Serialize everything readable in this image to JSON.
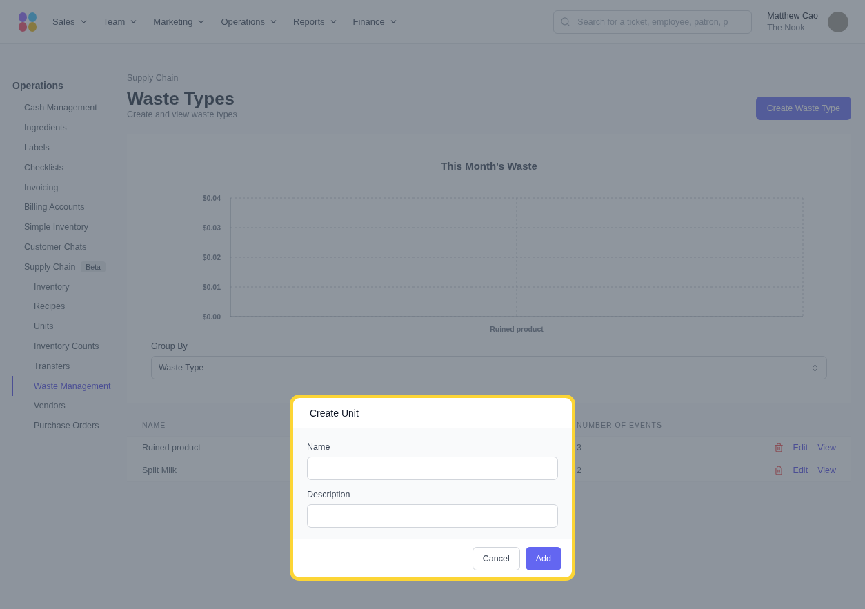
{
  "nav": {
    "items": [
      {
        "label": "Sales"
      },
      {
        "label": "Team"
      },
      {
        "label": "Marketing"
      },
      {
        "label": "Operations"
      },
      {
        "label": "Reports"
      },
      {
        "label": "Finance"
      }
    ],
    "search": {
      "placeholder": "Search for a ticket, employee, patron, p"
    },
    "user": {
      "name": "Matthew Cao",
      "location": "The Nook"
    }
  },
  "sidebar": {
    "title": "Operations",
    "items": [
      {
        "label": "Cash Management",
        "selected": false
      },
      {
        "label": "Ingredients",
        "selected": false
      },
      {
        "label": "Labels",
        "selected": false
      },
      {
        "label": "Checklists",
        "selected": false
      },
      {
        "label": "Invoicing",
        "selected": false
      },
      {
        "label": "Billing Accounts",
        "selected": false
      },
      {
        "label": "Simple Inventory",
        "selected": false
      },
      {
        "label": "Customer Chats",
        "selected": false
      },
      {
        "label": "Supply Chain",
        "selected": false,
        "badge": "Beta",
        "children": [
          {
            "label": "Inventory",
            "selected": false
          },
          {
            "label": "Recipes",
            "selected": false
          },
          {
            "label": "Units",
            "selected": false
          },
          {
            "label": "Inventory Counts",
            "selected": false
          },
          {
            "label": "Transfers",
            "selected": false
          },
          {
            "label": "Waste Management",
            "selected": true
          },
          {
            "label": "Vendors",
            "selected": false
          },
          {
            "label": "Purchase Orders",
            "selected": false
          }
        ]
      }
    ]
  },
  "header": {
    "breadcrumb": "Supply Chain",
    "title": "Waste Types",
    "subtitle": "Create and view waste types",
    "action": "Create Waste Type"
  },
  "chart": {
    "chart_data": {
      "type": "bar",
      "title": "This Month's Waste",
      "grid": true,
      "categories": [
        "Ruined product"
      ],
      "values": [
        0
      ],
      "ylim": [
        0,
        0.04
      ],
      "yticks": [
        {
          "value": 0,
          "label": "$0.00"
        },
        {
          "value": 0.01,
          "label": "$0.01"
        },
        {
          "value": 0.02,
          "label": "$0.02"
        },
        {
          "value": 0.03,
          "label": "$0.03"
        },
        {
          "value": 0.04,
          "label": "$0.04"
        }
      ]
    },
    "group_by": {
      "label": "Group By",
      "value": "Waste Type"
    }
  },
  "table": {
    "columns": [
      "NAME",
      "NUMBER OF EVENTS"
    ],
    "rows": [
      {
        "name": "Ruined product",
        "events": "3",
        "actions": [
          "Edit",
          "View"
        ]
      },
      {
        "name": "Spilt Milk",
        "events": "2",
        "actions": [
          "Edit",
          "View"
        ]
      }
    ]
  },
  "modal": {
    "title": "Create Unit",
    "fields": [
      {
        "label": "Name"
      },
      {
        "label": "Description"
      }
    ],
    "buttons": [
      {
        "label": "Cancel",
        "kind": "secondary"
      },
      {
        "label": "Add",
        "kind": "primary"
      }
    ]
  }
}
